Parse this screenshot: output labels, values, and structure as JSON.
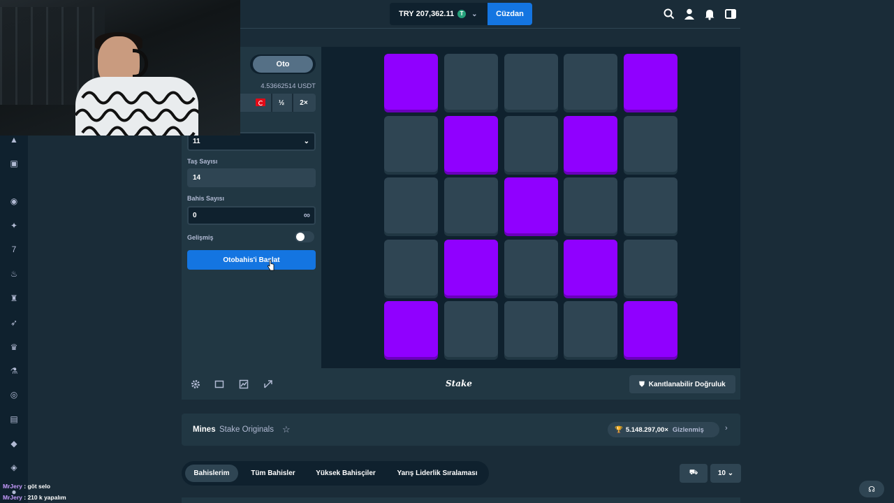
{
  "header": {
    "balance_currency": "TRY",
    "balance_amount": "207,362.11",
    "balance_coin": "T",
    "wallet_label": "Cüzdan"
  },
  "bet_panel": {
    "mode_label": "Oto",
    "usdt_value": "4.53662514 USDT",
    "half_label": "½",
    "double_label": "2×",
    "mines_value": "11",
    "gems_label": "Taş Sayısı",
    "gems_value": "14",
    "bet_count_label": "Bahis Sayısı",
    "bet_count_value": "0",
    "advanced_label": "Gelişmiş",
    "start_button_label": "Otobahis'i Başlat"
  },
  "board": {
    "tiles": [
      "gem",
      "gray",
      "gray",
      "gray",
      "gem",
      "gray",
      "gem",
      "gray",
      "gem",
      "gray",
      "gray",
      "gray",
      "gem",
      "gray",
      "gray",
      "gray",
      "gem",
      "gray",
      "gem",
      "gray",
      "gem",
      "gray",
      "gray",
      "gray",
      "gem"
    ],
    "gem_color": "#9000ff",
    "gray_color": "#2f4553"
  },
  "game_footer": {
    "logo_text": "Stake",
    "fairness_label": "Kanıtlanabilir Doğruluk"
  },
  "game_info": {
    "name": "Mines",
    "provider": "Stake Originals",
    "prize_value": "5.148.297,00×",
    "prize_hidden": "Gizlenmiş"
  },
  "bets_tabs": {
    "tabs": [
      "Bahislerim",
      "Tüm Bahisler",
      "Yüksek Bahisçiler",
      "Yarış Liderlik Sıralaması"
    ],
    "active_index": 0,
    "count_value": "10"
  },
  "chat": [
    {
      "user": "MrJery",
      "text": " : göt selo"
    },
    {
      "user": "MrJery",
      "text": " : 210 k yapalım"
    }
  ],
  "colors": {
    "accent_blue": "#1475e1",
    "bg_dark": "#0f212e",
    "bg_mid": "#213743"
  }
}
